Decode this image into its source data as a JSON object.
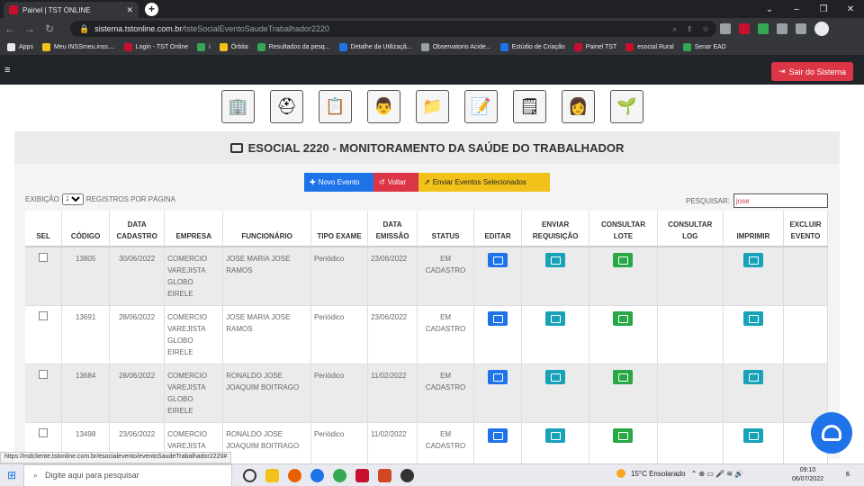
{
  "browser": {
    "tab_title": "Painel | TST ONLINE",
    "tab_close": "✕",
    "new_tab": "+",
    "win_controls": [
      "⌄",
      "–",
      "❐",
      "✕"
    ],
    "url_host": "sistema.tstonline.com.br",
    "url_path": "/tsteSocialEventoSaudeTrabalhador2220",
    "bookmarks": [
      {
        "label": "Apps",
        "color": "#e8eaed"
      },
      {
        "label": "Meu INSSmeu.inss....",
        "color": "#f2c21a"
      },
      {
        "label": "Login - TST Online",
        "color": "#c8102e"
      },
      {
        "label": "i",
        "color": "#34a853"
      },
      {
        "label": "Órbita",
        "color": "#f2c21a"
      },
      {
        "label": "Resultados da pesq...",
        "color": "#34a853"
      },
      {
        "label": "Detalhe da Utilizaçã...",
        "color": "#1e73e8"
      },
      {
        "label": "Observatorio Acide...",
        "color": "#9aa0a6"
      },
      {
        "label": "Estúdio de Criação",
        "color": "#1e73e8"
      },
      {
        "label": "Painel TST",
        "color": "#c8102e"
      },
      {
        "label": "esocial Rural",
        "color": "#c8102e"
      },
      {
        "label": "Senar EAD",
        "color": "#34a853"
      }
    ]
  },
  "header": {
    "menu_icon": "≡",
    "logout_label": "Sair do Sistema",
    "nav_icons": [
      "building-icon",
      "helmet-icon",
      "medical-chart-icon",
      "doctor-icon",
      "folder-icon",
      "clipboard-icon",
      "medical-clipboard-icon",
      "nurse-icon",
      "plant-hands-icon"
    ]
  },
  "page": {
    "title": "ESOCIAL 2220 - MONITORAMENTO DA SAÚDE DO TRABALHADOR",
    "btn_new": "Novo Evento",
    "btn_back": "Voltar",
    "btn_send": "Enviar Eventos Selecionados",
    "show_prefix": "EXIBIÇÃO",
    "show_value": "20",
    "show_suffix": "REGISTROS POR PÁGINA",
    "search_label": "PESQUISAR:",
    "search_value": "jose"
  },
  "table": {
    "headers": [
      "SEL",
      "CÓDIGO",
      "DATA CADASTRO",
      "EMPRESA",
      "FUNCIONÁRIO",
      "TIPO EXAME",
      "DATA EMISSÃO",
      "STATUS",
      "EDITAR",
      "ENVIAR REQUISIÇÃO",
      "CONSULTAR LOTE",
      "CONSULTAR LOG",
      "IMPRIMIR",
      "EXCLUIR EVENTO"
    ],
    "rows": [
      {
        "code": "13805",
        "date": "30/06/2022",
        "company": "COMERCIO VAREJISTA GLOBO EIRELE",
        "employee": "JOSE MARIA JOSE RAMOS",
        "exam": "Periódico",
        "emission": "23/06/2022",
        "status": "EM CADASTRO"
      },
      {
        "code": "13691",
        "date": "28/06/2022",
        "company": "COMERCIO VAREJISTA GLOBO EIRELE",
        "employee": "JOSE MARIA JOSE RAMOS",
        "exam": "Periódico",
        "emission": "23/06/2022",
        "status": "EM CADASTRO"
      },
      {
        "code": "13684",
        "date": "28/06/2022",
        "company": "COMERCIO VAREJISTA GLOBO EIRELE",
        "employee": "RONALDO JOSE JOAQUIM BOITRAGO",
        "exam": "Periódico",
        "emission": "11/02/2022",
        "status": "EM CADASTRO"
      },
      {
        "code": "13498",
        "date": "23/06/2022",
        "company": "COMERCIO VAREJISTA GLOBO EIRELE",
        "employee": "RONALDO JOSE JOAQUIM BOITRAGO",
        "exam": "Periódico",
        "emission": "11/02/2022",
        "status": "EM CADASTRO"
      }
    ]
  },
  "statusbar": {
    "url": "https://mdcliente.tstonline.com.br/esocialevento/eventoSaudeTrabalhador2220#"
  },
  "taskbar": {
    "start_icon": "⊞",
    "search_placeholder": "Digite aqui para pesquisar",
    "weather": "15°C  Ensolarado",
    "time": "09:10",
    "date": "06/07/2022",
    "notif_count": "6"
  },
  "colors": {
    "primary": "#1e73e8",
    "danger": "#dc3545",
    "warning": "#f2c21a",
    "teal": "#17a2b8",
    "success": "#28a745"
  }
}
